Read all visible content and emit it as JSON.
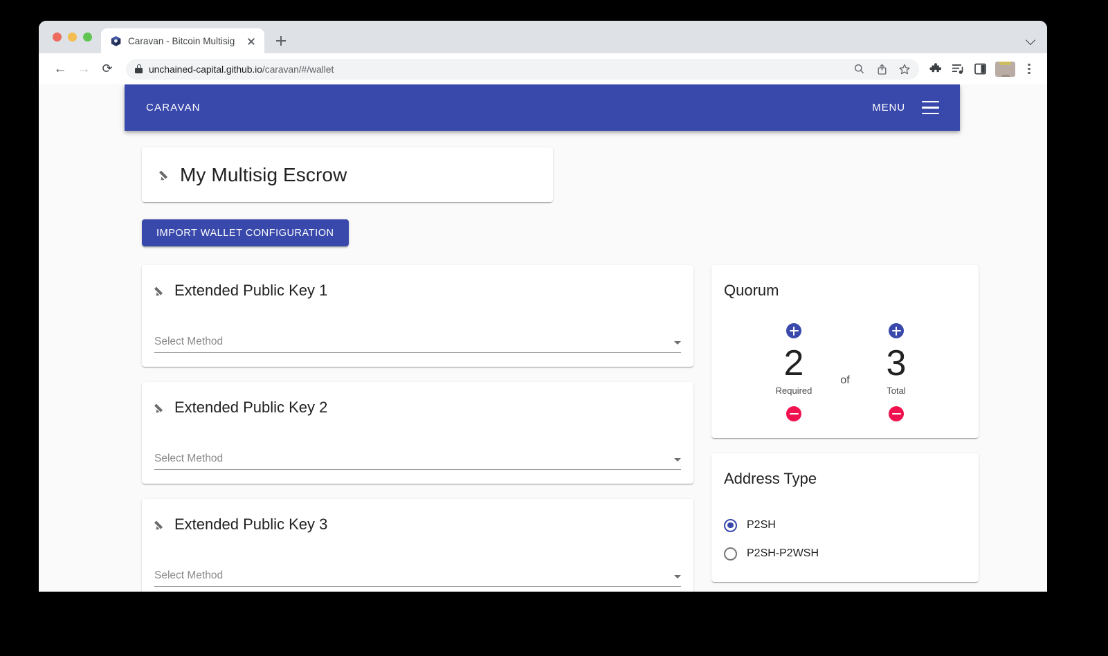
{
  "browser": {
    "tab": {
      "title": "Caravan - Bitcoin Multisig",
      "favicon": "caravan-cube-icon",
      "close_icon": "close-icon"
    },
    "new_tab_icon": "plus-icon",
    "tabstrip_chevron_icon": "chevron-down-icon",
    "nav": {
      "back_icon": "arrow-left-icon",
      "back_glyph": "←",
      "forward_icon": "arrow-right-icon",
      "forward_glyph": "→",
      "reload_icon": "reload-icon",
      "reload_glyph": "⟳"
    },
    "omnibox": {
      "lock_icon": "lock-icon",
      "url_main": "unchained-capital.github.io",
      "url_path": "/caravan/#/wallet",
      "search_icon": "search-icon",
      "search_glyph": "⌕",
      "share_icon": "share-icon",
      "share_glyph": "⇧",
      "bookmark_icon": "star-icon",
      "bookmark_glyph": "☆"
    },
    "toolbar_icons": {
      "extensions_icon": "puzzle-piece-icon",
      "extensions_glyph": "✦",
      "reading_list_icon": "reading-list-icon",
      "reading_list_glyph": "☰",
      "side_panel_icon": "side-panel-icon",
      "side_panel_glyph": "▣",
      "profile_icon": "avatar-icon",
      "menu_icon": "kebab-menu-icon"
    }
  },
  "app": {
    "brand": "CARAVAN",
    "menu_label": "MENU",
    "hamburger_icon": "hamburger-menu-icon",
    "accent_blue": "#3949ab",
    "accent_red": "#f0124f",
    "wallet_name": {
      "edit_icon": "pencil-edit-icon",
      "value": "My Multisig Escrow"
    },
    "import_button": "IMPORT WALLET CONFIGURATION",
    "xpubs": [
      {
        "edit_icon": "pencil-edit-icon",
        "title": "Extended Public Key 1",
        "select_placeholder": "Select Method",
        "caret_icon": "chevron-down-icon"
      },
      {
        "edit_icon": "pencil-edit-icon",
        "title": "Extended Public Key 2",
        "select_placeholder": "Select Method",
        "caret_icon": "chevron-down-icon"
      },
      {
        "edit_icon": "pencil-edit-icon",
        "title": "Extended Public Key 3",
        "select_placeholder": "Select Method",
        "caret_icon": "chevron-down-icon"
      }
    ],
    "quorum": {
      "title": "Quorum",
      "conjunction": "of",
      "required": {
        "increment_icon": "plus-circle-icon",
        "value": "2",
        "label": "Required",
        "decrement_icon": "minus-circle-icon"
      },
      "total": {
        "increment_icon": "plus-circle-icon",
        "value": "3",
        "label": "Total",
        "decrement_icon": "minus-circle-icon"
      }
    },
    "address_type": {
      "title": "Address Type",
      "selected": "P2SH",
      "options": [
        {
          "label": "P2SH",
          "checked": true
        },
        {
          "label": "P2SH-P2WSH",
          "checked": false
        }
      ]
    }
  }
}
